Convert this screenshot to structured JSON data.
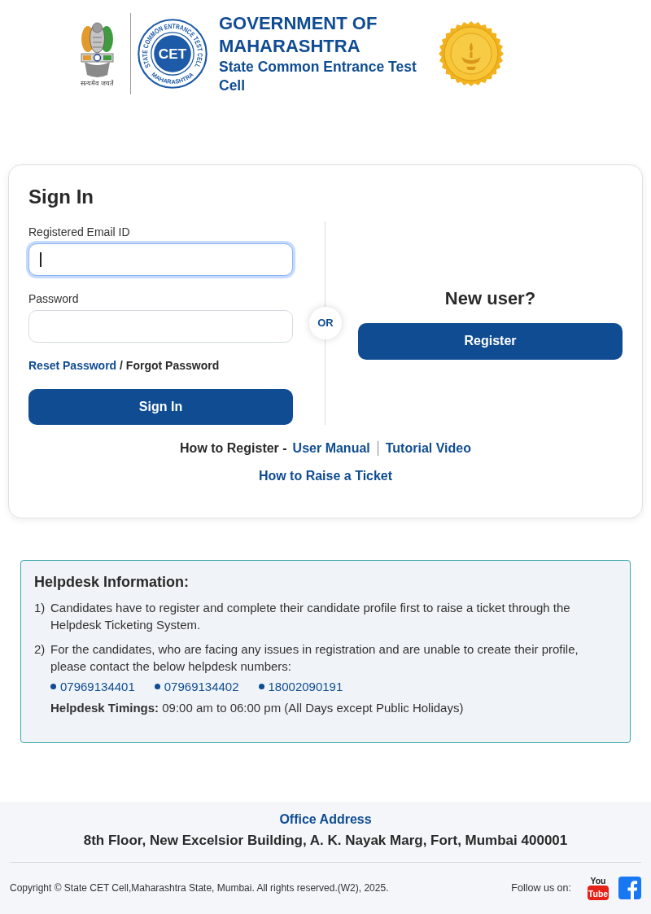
{
  "header": {
    "emblem": {
      "motto": "सत्यमेव जयते"
    },
    "cet_logo": {
      "ring_text": "STATE COMMON ENTRANCE TEST CELL",
      "monogram": "CET",
      "bottom_text": "MAHARASHTRA"
    },
    "title": "GOVERNMENT OF MAHARASHTRA",
    "subtitle": "State Common Entrance Test Cell"
  },
  "sign_in": {
    "title": "Sign In",
    "fields": [
      {
        "label": "Registered Email ID",
        "focused": true
      },
      {
        "label": "Password",
        "focused": false
      }
    ],
    "reset_link": "Reset Password",
    "separator": "/",
    "forgot_link": "Forgot Password",
    "button": "Sign In"
  },
  "or_badge": "OR",
  "new_user": {
    "heading": "New user?",
    "button": "Register"
  },
  "help_links": {
    "label": "How to Register -",
    "links": [
      "User Manual",
      "Tutorial Video"
    ],
    "ticket_link": "How to Raise a Ticket"
  },
  "helpdesk": {
    "title": "Helpdesk Information:",
    "items": [
      {
        "number": "1)",
        "text": "Candidates have to register and complete their candidate profile first to raise a ticket through the Helpdesk Ticketing System."
      },
      {
        "number": "2)",
        "text": "For the candidates, who are facing any issues in registration and are unable to create their profile, please contact the below helpdesk numbers:",
        "phones": [
          "07969134401",
          "07969134402",
          "18002090191"
        ],
        "timings": "**Helpdesk Timings:** 09:00 am to 06:00 pm (All Days except Public Holidays)"
      }
    ]
  },
  "footer": {
    "heading": "Office Address",
    "address": "8th Floor, New Excelsior Building, A. K. Nayak Marg, Fort, Mumbai 400001",
    "copyright": "Copyright © State CET Cell,Maharashtra State, Mumbai. All rights reserved.(W2), 2025.",
    "follow_label": "Follow us on:",
    "social": [
      {
        "kind": "youtube",
        "text_lines": [
          "You",
          "Tube"
        ]
      },
      {
        "kind": "facebook"
      }
    ]
  }
}
